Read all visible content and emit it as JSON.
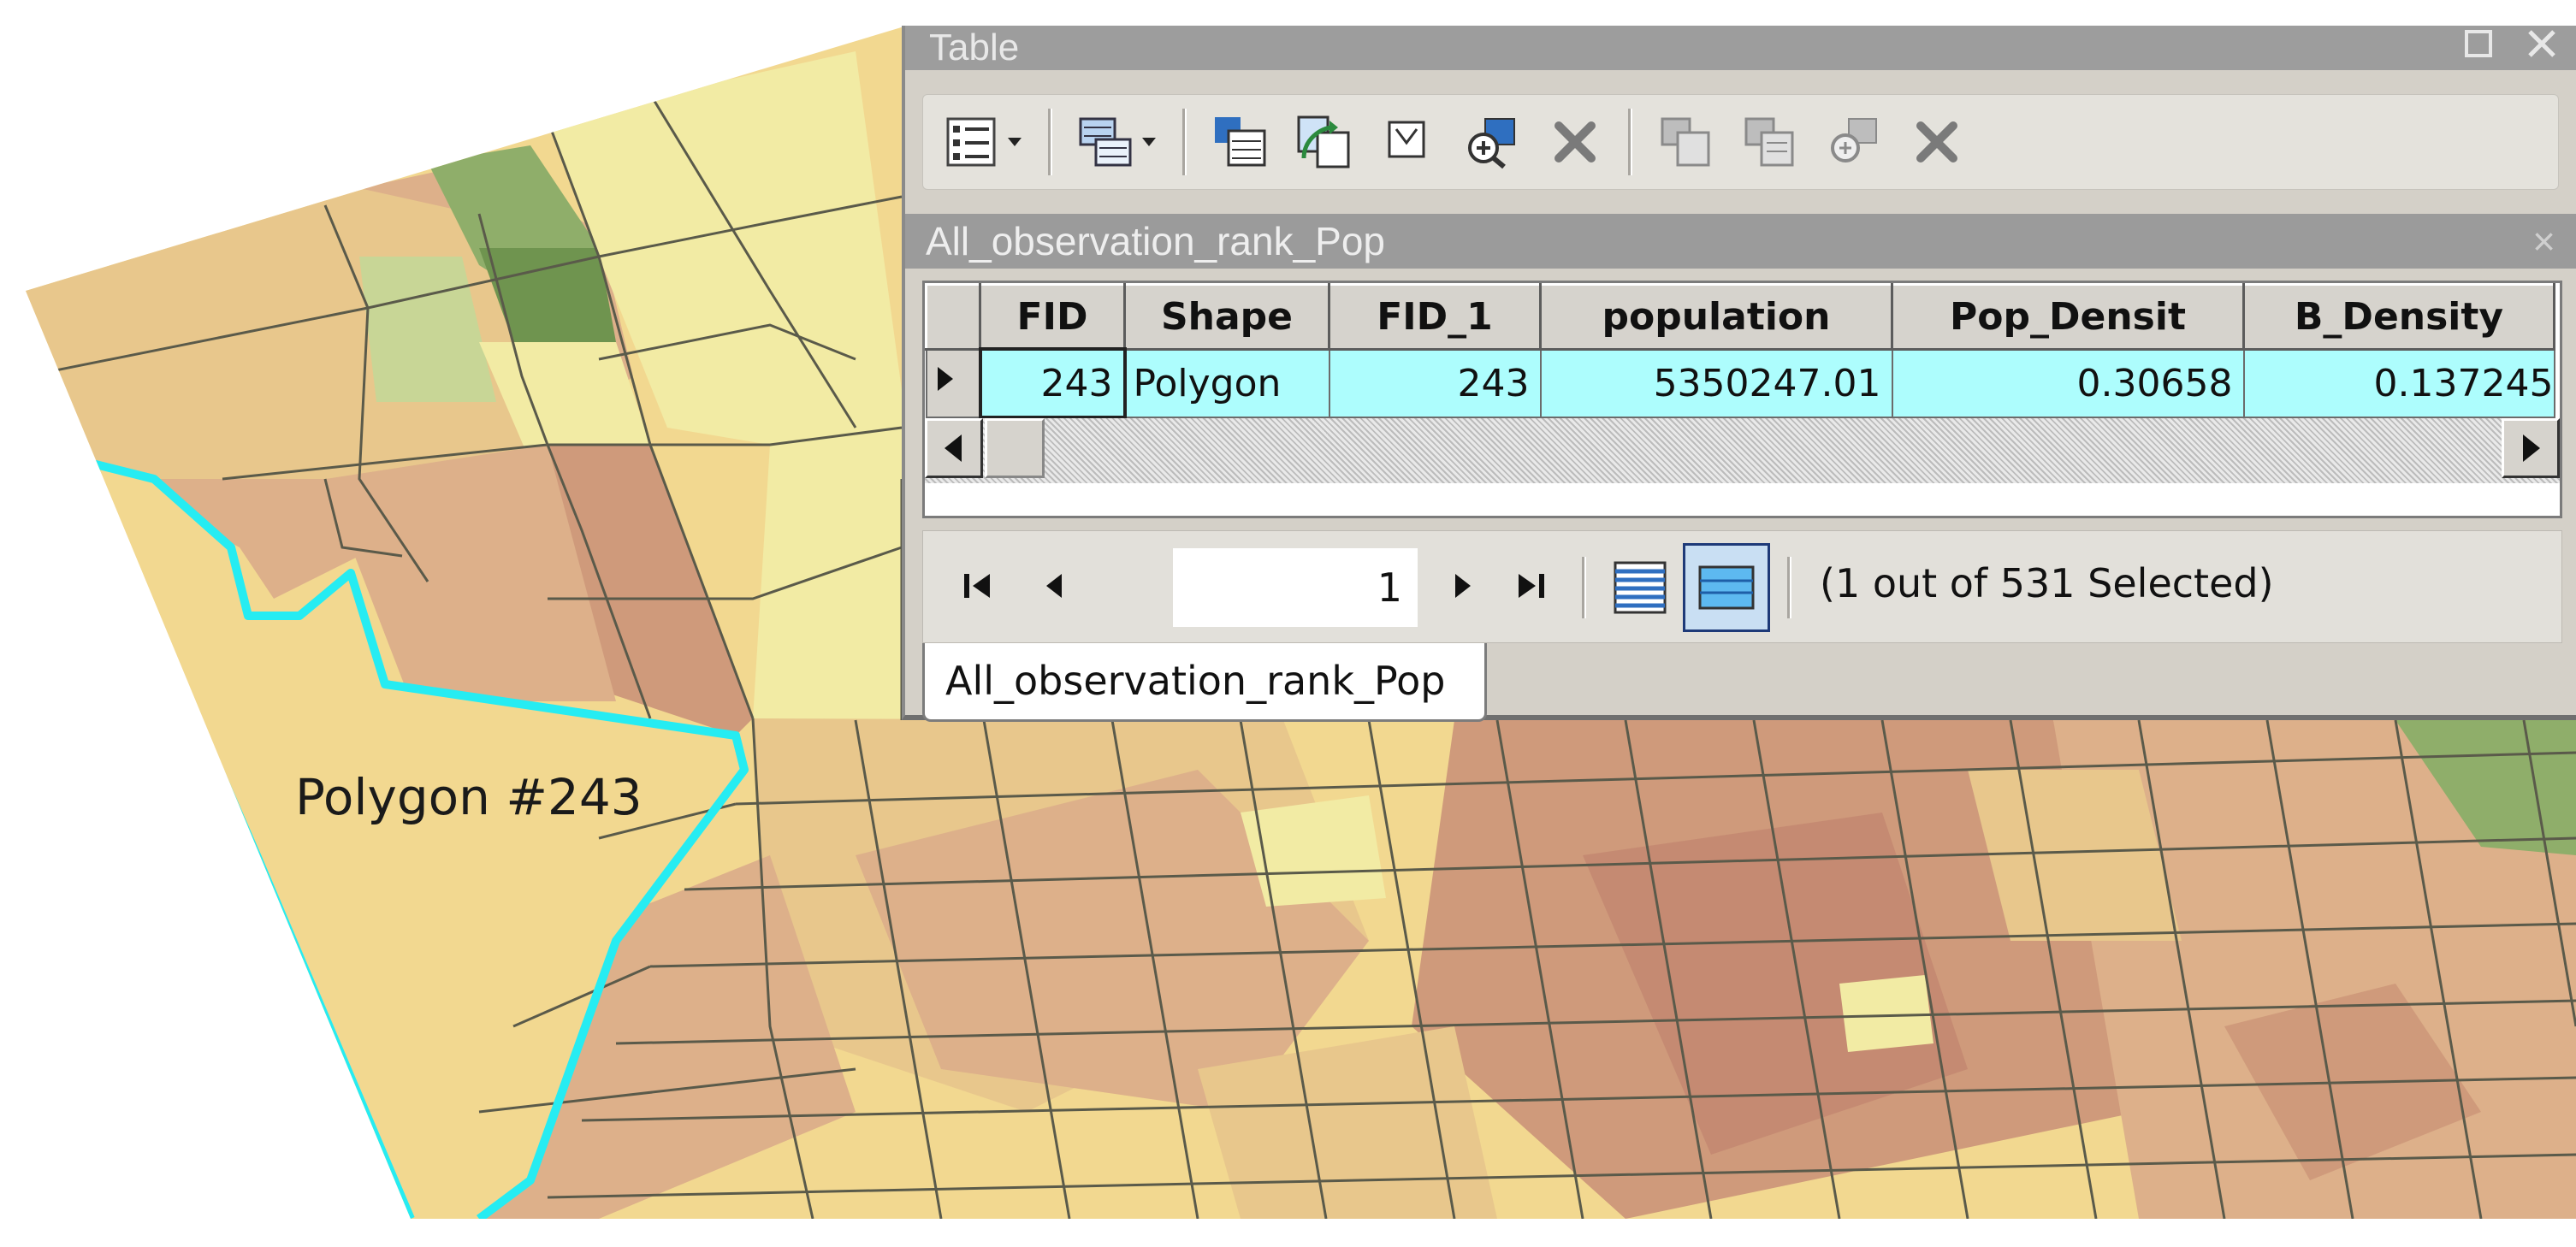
{
  "map": {
    "label": "Polygon #243",
    "colors": {
      "tan_light": "#f2d890",
      "tan": "#e8c78c",
      "brown_light": "#ddb08a",
      "brown": "#cf9a7b",
      "brown_dark": "#c58a72",
      "yellow_light": "#f2eba4",
      "green_light": "#c8d696",
      "green": "#8fae6a",
      "green_dark": "#6f944f",
      "outline": "#5a5a4a",
      "selection": "#26ecf2"
    }
  },
  "window": {
    "title": "Table",
    "controls": [
      "restore-icon",
      "close-icon"
    ],
    "toolbar": {
      "icons": [
        "table-options-icon",
        "related-tables-icon",
        "select-by-attributes-icon",
        "switch-selection-icon",
        "clear-selection-icon",
        "zoom-to-selected-icon",
        "delete-selected-icon",
        "copy-records-icon",
        "paste-records-icon",
        "zoom-records-icon",
        "delete-records-icon"
      ]
    },
    "tab_title": "All_observation_rank_Pop",
    "close_label": "×",
    "columns": [
      "FID",
      "Shape",
      "FID_1",
      "population",
      "Pop_Densit",
      "B_Density"
    ],
    "rows": [
      [
        "243",
        "Polygon",
        "243",
        "5350247.01",
        "0.30658",
        "0.137245"
      ]
    ],
    "navigation": {
      "current_record": "1",
      "selection_status": "(1 out of 531 Selected)"
    },
    "bottom_tab": "All_observation_rank_Pop"
  }
}
